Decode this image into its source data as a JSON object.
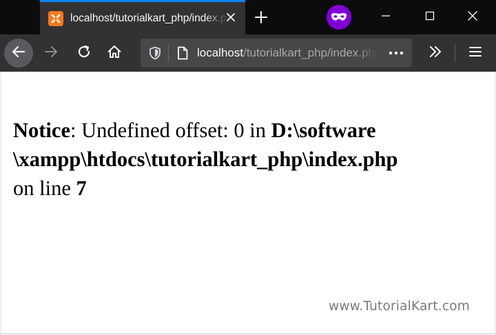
{
  "tab": {
    "title": "localhost/tutorialkart_php/index.php",
    "favicon": "xampp-icon"
  },
  "address_bar": {
    "host": "localhost",
    "path": "/tutorialkart_php/index.php"
  },
  "icons": {
    "back": "arrow-left-icon",
    "forward": "arrow-right-icon",
    "reload": "reload-icon",
    "home": "home-icon",
    "shield": "tracking-protection-shield-icon",
    "page": "page-icon",
    "page_actions": "ellipsis-icon",
    "overflow": "double-chevron-right-icon",
    "menu": "hamburger-menu-icon",
    "private": "private-browsing-mask-icon",
    "new_tab": "plus-icon"
  },
  "colors": {
    "tab_accent": "#0a84ff",
    "private_badge": "#8000d7",
    "favicon_bg": "#f37a1f",
    "chrome_dark": "#0c0c0d",
    "toolbar": "#323234"
  },
  "notice": {
    "label": "Notice",
    "message": ": Undefined offset: 0 in ",
    "path_line1": "D:\\software",
    "path_line2": "\\xampp\\htdocs\\tutorialkart_php\\index.php",
    "line_prefix": "on line ",
    "line_number": "7"
  },
  "watermark": "www.TutorialKart.com"
}
